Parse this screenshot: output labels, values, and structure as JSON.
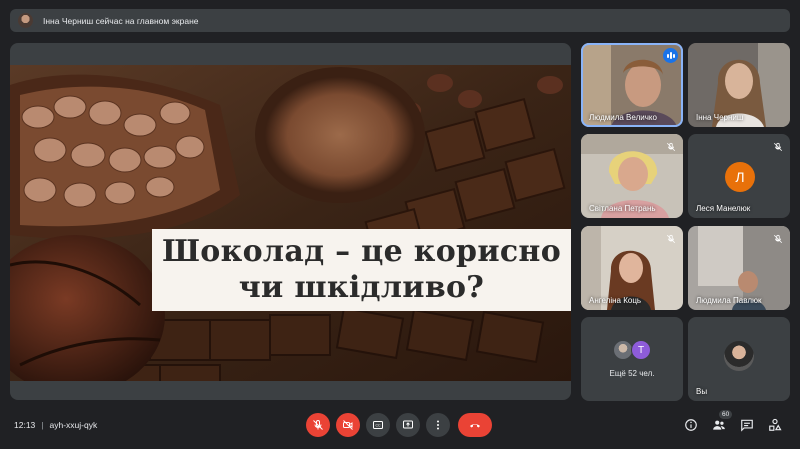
{
  "banner": {
    "text": "Інна Черниш сейчас на главном экране"
  },
  "slide": {
    "title_line1": "Шоколад – це корисно",
    "title_line2": "чи шкідливо?"
  },
  "participants": [
    {
      "name": "Людмила Величко",
      "speaking": true
    },
    {
      "name": "Інна Черниш",
      "muted": false
    },
    {
      "name": "Світлана Петрань",
      "muted": true
    },
    {
      "name": "Леся Манелюк",
      "muted": true,
      "initial": "Л"
    },
    {
      "name": "Ангеліна Коць",
      "muted": true
    },
    {
      "name": "Людмила Павлюк",
      "muted": true
    }
  ],
  "more_tile": {
    "initial": "Т",
    "label": "Ещё 52 чел."
  },
  "self_tile": {
    "label": "Вы"
  },
  "bottombar": {
    "time": "12:13",
    "separator": "|",
    "meeting_code": "ayh-xxuj-qyk",
    "participants_count": "60"
  },
  "colors": {
    "background": "#202124",
    "surface": "#3c4043",
    "danger": "#ea4335",
    "accent": "#1a73e8",
    "avatar_orange": "#e8710a",
    "avatar_purple": "#8e5cd9"
  },
  "icons": {
    "mic": "mic-off-icon",
    "camera": "camera-off-icon",
    "captions": "captions-icon",
    "present": "present-icon",
    "more": "more-vert-icon",
    "hangup": "hangup-icon",
    "info": "info-icon",
    "people": "people-icon",
    "chat": "chat-icon",
    "activities": "activities-icon"
  }
}
